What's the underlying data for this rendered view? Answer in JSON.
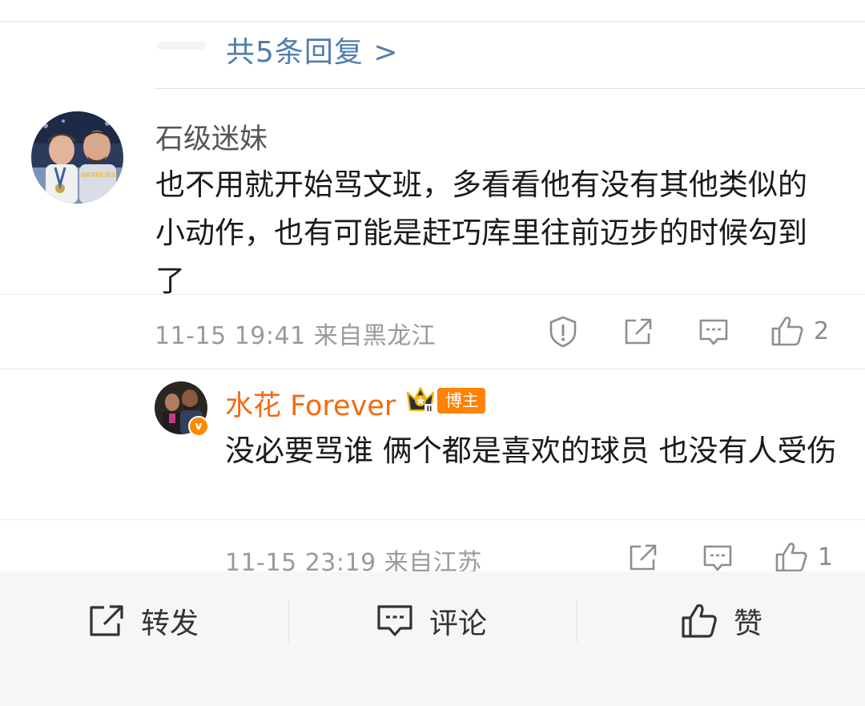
{
  "replies": {
    "link_text": "共5条回复 >"
  },
  "comment": {
    "username": "石级迷妹",
    "text": "也不用就开始骂文班，多看看他有没有其他类似的小动作，也有可能是赶巧库里往前迈步的时候勾到了",
    "meta": "11-15 19:41 来自黑龙江",
    "like_count": "2",
    "icons": [
      "report-icon",
      "repost-icon",
      "comment-icon",
      "like-icon"
    ]
  },
  "reply": {
    "username": "水花 Forever",
    "badge": "博主",
    "verified_mark": "v",
    "crown_level": "II",
    "text": "没必要骂谁 俩个都是喜欢的球员 也没有人受伤",
    "meta": "11-15 23:19 来自江苏",
    "like_count": "1",
    "icons": [
      "repost-icon",
      "comment-icon",
      "like-icon"
    ]
  },
  "bottom_bar": {
    "repost_label": "转发",
    "comment_label": "评论",
    "like_label": "赞"
  },
  "colors": {
    "link": "#507daf",
    "blogger_name": "#f36a0e",
    "badge": "#ff8200",
    "meta": "#9a9a9a"
  }
}
